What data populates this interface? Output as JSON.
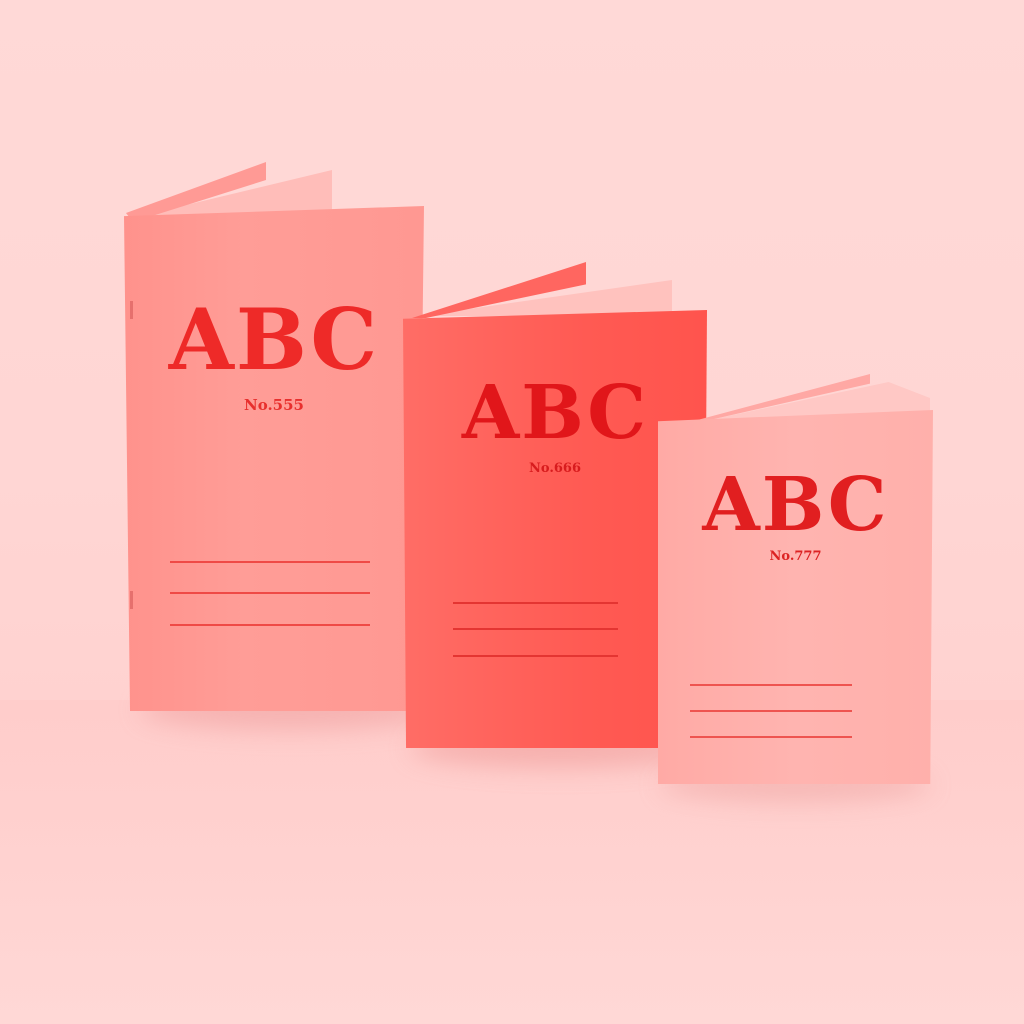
{
  "scene": {
    "description_colors": {
      "background": "#ffd8d6",
      "ink": "#e82424"
    }
  },
  "notebooks": [
    {
      "title": "ABC",
      "number": "No.555",
      "cover_color": "#ff9a94"
    },
    {
      "title": "ABC",
      "number": "No.666",
      "cover_color": "#ff5e57"
    },
    {
      "title": "ABC",
      "number": "No.777",
      "cover_color": "#ffb0ab"
    }
  ]
}
